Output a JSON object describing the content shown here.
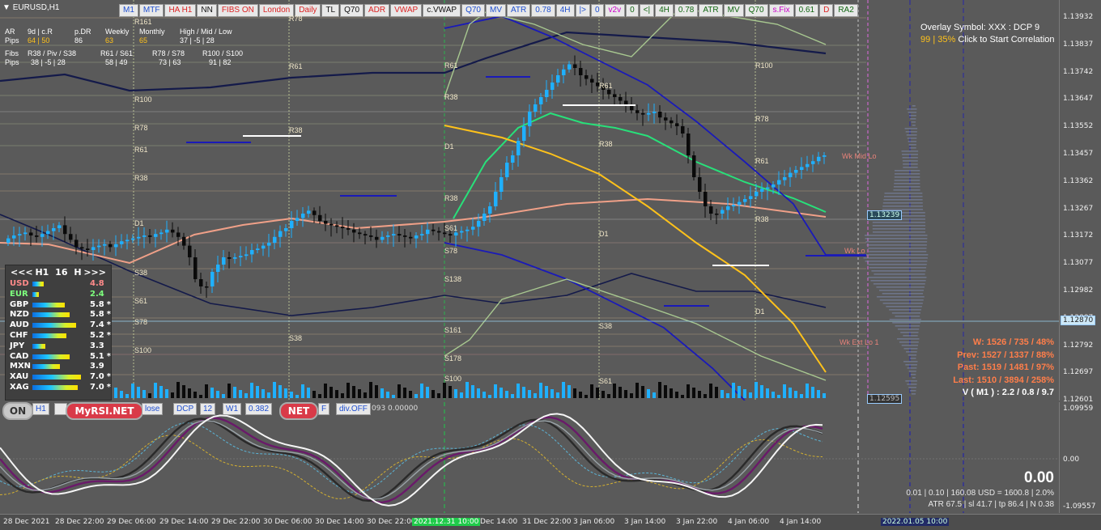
{
  "symbol": "EURUSD,H1",
  "toolbar": [
    {
      "label": "M1",
      "style": "blue"
    },
    {
      "label": "MTF",
      "style": "blue"
    },
    {
      "label": "HA H1",
      "style": "red"
    },
    {
      "label": "NN",
      "style": "blk"
    },
    {
      "label": "FIBS ON",
      "style": "red"
    },
    {
      "label": "London",
      "style": "red"
    },
    {
      "label": "Daily",
      "style": "red"
    },
    {
      "label": "TL",
      "style": "blk"
    },
    {
      "label": "Q70",
      "style": "blk"
    },
    {
      "label": "ADR",
      "style": "red"
    },
    {
      "label": "VWAP",
      "style": "red"
    },
    {
      "label": "c.VWAP",
      "style": "blk"
    },
    {
      "label": "Q70",
      "style": "blue"
    },
    {
      "label": "MV",
      "style": "blue"
    },
    {
      "label": "ATR",
      "style": "blue"
    },
    {
      "label": "0.78",
      "style": "blue"
    },
    {
      "label": "4H",
      "style": "blue"
    },
    {
      "label": "|>",
      "style": "blue"
    },
    {
      "label": "0",
      "style": "blue"
    },
    {
      "label": "v2v",
      "style": "mag"
    },
    {
      "label": "0",
      "style": "grn"
    },
    {
      "label": "<|",
      "style": "grn"
    },
    {
      "label": "4H",
      "style": "grn"
    },
    {
      "label": "0.78",
      "style": "grn"
    },
    {
      "label": "ATR",
      "style": "grn"
    },
    {
      "label": "MV",
      "style": "grn"
    },
    {
      "label": "Q70",
      "style": "grn"
    },
    {
      "label": "s.Fix",
      "style": "mag"
    },
    {
      "label": "0.61",
      "style": "grn"
    },
    {
      "label": "D",
      "style": "red"
    },
    {
      "label": "RA2",
      "style": "grn"
    }
  ],
  "stats": {
    "header": [
      "AR",
      "9d | c.R",
      "p.DR",
      "Weekly",
      "Monthly",
      "High / Mid / Low"
    ],
    "pips_label": "Pips",
    "pips_vals": [
      "64 | 50",
      "86",
      "63",
      "65",
      "37 | -5 | 28"
    ],
    "fibs_label": "Fibs",
    "fibs_head": [
      "R38 / Piv / S38",
      "R61 / S61",
      "R78 / S78",
      "R100 / S100"
    ],
    "pips2_vals": [
      "38 | -5 | 28",
      "58 | 49",
      "73 | 63",
      "91 | 82"
    ]
  },
  "overlay": {
    "line1": "Overlay Symbol: XXX : DCP 9",
    "line2_a": "99",
    "line2_b": "35%",
    "line2_c": "Click to Start Correlation"
  },
  "price_axis": [
    "1.13932",
    "1.13837",
    "1.13742",
    "1.13647",
    "1.13552",
    "1.13457",
    "1.13362",
    "1.13267",
    "1.13172",
    "1.13077",
    "1.12982",
    "1.12887",
    "1.12792",
    "1.12697",
    "1.12601"
  ],
  "current_price": "1.12870",
  "price_tag_mid": "1.13239",
  "price_tag_low": "1.12595",
  "osc_axis": [
    "1.09959",
    "0.00",
    "-1.09557"
  ],
  "time_axis": [
    "28 Dec 2021",
    "28 Dec 22:00",
    "29 Dec 06:00",
    "29 Dec 14:00",
    "29 Dec 22:00",
    "30 Dec 06:00",
    "30 Dec 14:00",
    "30 Dec 22:00",
    "2021.12.31 10:00",
    "Dec 14:00",
    "31 Dec 22:00",
    "3 Jan 06:00",
    "3 Jan 14:00",
    "3 Jan 22:00",
    "4 Jan 06:00",
    "4 Jan 14:00",
    "2022.01.05 10:00"
  ],
  "strength": {
    "nav_prev": "<<<",
    "tf": "H1",
    "num": "16",
    "unit": "H",
    "nav_next": ">>>",
    "rows": [
      {
        "name": "USD",
        "val": "4.8",
        "color": "#ff8a8a",
        "star": ""
      },
      {
        "name": "EUR",
        "val": "2.4",
        "color": "#7dff7d",
        "star": ""
      },
      {
        "name": "GBP",
        "val": "5.8",
        "color": "#ffffff",
        "star": "*"
      },
      {
        "name": "NZD",
        "val": "5.8",
        "color": "#ffffff",
        "star": "*"
      },
      {
        "name": "AUD",
        "val": "7.4",
        "color": "#ffffff",
        "star": "*"
      },
      {
        "name": "CHF",
        "val": "5.2",
        "color": "#ffffff",
        "star": "*"
      },
      {
        "name": "JPY",
        "val": "3.3",
        "color": "#ffffff",
        "star": ""
      },
      {
        "name": "CAD",
        "val": "5.1",
        "color": "#ffffff",
        "star": "*"
      },
      {
        "name": "MXN",
        "val": "3.9",
        "color": "#ffffff",
        "star": ""
      },
      {
        "name": "XAU",
        "val": "7.0",
        "color": "#ffffff",
        "star": "*"
      },
      {
        "name": "XAG",
        "val": "7.0",
        "color": "#ffffff",
        "star": "*"
      }
    ]
  },
  "bottom": {
    "on": "ON",
    "h1": "H1",
    "myrsi": "MyRSI.NET",
    "net": "NET",
    "close": "lose",
    "dcp": "DCP",
    "n12": "12",
    "w1": "W1",
    "fib": "0.382",
    "f": "F",
    "div": "div.OFF",
    "osc_val": "093 0.00000"
  },
  "wk": {
    "w": "W: 1526 / 735 / 48%",
    "prev": "Prev: 1527 / 1337 / 88%",
    "past": "Past: 1519 / 1481 / 97%",
    "last": "Last: 1510 / 3894 / 258%",
    "v": "V ( M1 ) : 2.2 / 0.8 / 9.7"
  },
  "osc_readout": {
    "big": "0.00",
    "line1": "0.01  |  0.10  |  160.08 USD = 1600.8  |  2.0%",
    "line2": "ATR 67.5  | sl 41.7  | tp 86.4  | N 0.38"
  },
  "levels": [
    "R161",
    "R78",
    "R61",
    "R100",
    "R38",
    "R78",
    "R61",
    "D1",
    "S38",
    "S61",
    "S78",
    "S100",
    "R38",
    "R61",
    "R38",
    "D1",
    "R38",
    "S38",
    "S61",
    "S78",
    "S138",
    "S161",
    "S178",
    "S100",
    "R61",
    "R78",
    "R100",
    "R38",
    "R61",
    "D1",
    "S38",
    "S61",
    "R38",
    "D1",
    "Wk Mid Lo",
    "Wk Lo",
    "Wk Ext Lo 1"
  ],
  "colors": {
    "bull": "#1fb0ff",
    "bear": "#0a0a0a",
    "ma_green": "#28e07a",
    "ma_salmon": "#f0a088",
    "ma_yellow": "#ffc21a",
    "band_blue": "#1a1ab8"
  }
}
